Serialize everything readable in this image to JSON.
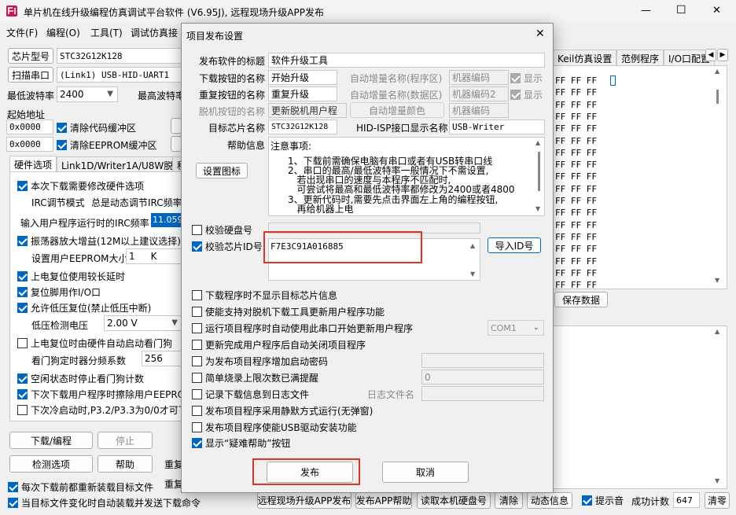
{
  "window": {
    "title": "单片机在线升级编程仿真调试平台软件 (V6.95J), 远程现场升级APP发布",
    "controls": {
      "minimize": "—",
      "maximize": "☐",
      "close": "✕"
    }
  },
  "menu": [
    "文件(F)",
    "编程(O)",
    "工具(T)",
    "调试仿真接"
  ],
  "left": {
    "chip_type_label": "芯片型号",
    "chip_type_value": "STC32G12K128",
    "scan_port_label": "扫描串口",
    "port_value": "(Link1) USB-HID-UART1",
    "min_baud_label": "最低波特率",
    "min_baud_value": "2400",
    "max_baud_label": "最高波特率",
    "start_addr_label": "起始地址",
    "addr1": "0x0000",
    "clear_code": "清除代码缓冲区",
    "addr2": "0x0000",
    "clear_eeprom": "清除EEPROM缓冲区",
    "tabs": [
      "硬件选项",
      "Link1D/Writer1A/U8W脱机",
      "程"
    ],
    "options": {
      "modify_hw": "本次下载需要修改硬件选项",
      "irc_mode_label": "IRC调节模式",
      "irc_mode_value": "总是动态调节IRC频率",
      "irc_freq_label": "输入用户程序运行时的IRC频率",
      "irc_freq_value": "11.0592",
      "osc_gain": "振荡器放大增益(12M以上建议选择)",
      "eeprom_size_label": "设置用户EEPROM大小",
      "eeprom_size_value": "1",
      "eeprom_size_unit": "K",
      "por_delay": "上电复位使用较长延时",
      "reset_io": "复位脚用作I/O口",
      "lvr": "允许低压复位(禁止低压中断)",
      "lvd_label": "低压检测电压",
      "lvd_value": "2.00 V",
      "wdt_auto": "上电复位时由硬件自动启动看门狗",
      "wdt_div_label": "看门狗定时器分频系数",
      "wdt_div_value": "256",
      "wdt_idle": "空闲状态时停止看门狗计数",
      "erase_eeprom": "下次下载用户程序时擦除用户EEPROM",
      "p32p33": "下次冷启动时,P3.2/P3.3为0/0才可下"
    },
    "btn_download": "下载/编程",
    "btn_stop": "停止",
    "btn_check": "检测选项",
    "btn_help": "帮助",
    "redl1": "重复",
    "redl2": "重复",
    "reload_each": "每次下载前都重新装载目标文件",
    "auto_send": "当目标文件变化时自动装载并发送下载命令"
  },
  "right": {
    "tabs": [
      "Keil仿真设置",
      "范例程序",
      "I/O口配置"
    ],
    "hex_line": "FF FF FF",
    "save_data": "保存数据"
  },
  "bottom": {
    "remote_publish": "远程现场升级APP发布",
    "publish_help": "发布APP帮助",
    "read_disk": "读取本机硬盘号",
    "clear": "清除",
    "dyn_info": "动态信息",
    "beep": "提示音",
    "success_count_label": "成功计数",
    "success_count": "647",
    "clear_zero": "清零"
  },
  "dialog": {
    "title": "项目发布设置",
    "close": "✕",
    "publish_title_label": "发布软件的标题",
    "publish_title_value": "软件升级工具",
    "dl_btn_name_label": "下载按钮的名称",
    "dl_btn_name_value": "开始升级",
    "auto_inc_prog_label": "自动增量名称(程序区)",
    "machine_code1": "机器编码",
    "show1": "显示",
    "re_btn_name_label": "重复按钮的名称",
    "re_btn_name_value": "重复升级",
    "auto_inc_data_label": "自动增量名称(数据区)",
    "machine_code2": "机器编码2",
    "show2": "显示",
    "offline_btn_label": "脱机按钮的名称",
    "offline_btn_value": "更新脱机用户程",
    "auto_inc_color": "自动增量颜色",
    "machine_code3": "机器编码",
    "target_chip_label": "目标芯片名称",
    "target_chip_value": "STC32G12K128",
    "hid_name_label": "HID-ISP接口显示名称",
    "hid_name_value": "USB-Writer",
    "help_label": "帮助信息",
    "help_text_title": "注意事项:",
    "help_lines": [
      "1、下载前需确保电脑有串口或者有USB转串口线",
      "2、串口的最高/最低波特率一般情况下不需设置,",
      "   若出现串口的速度与本程序不匹配时,",
      "   可尝试将最高和最低波特率都修改为2400或者4800",
      "3、更新代码时,需要先点击界面左上角的编程按钮,",
      "   再给机器上电"
    ],
    "set_icon": "设置图标",
    "verify_disk": "校验硬盘号",
    "verify_chip": "校验芯片ID号",
    "chip_id_value": "F7E3C91A016885",
    "import_id": "导入ID号",
    "opt1": "下载程序时不显示目标芯片信息",
    "opt2": "使能支持对脱机下载工具更新用户程序功能",
    "opt3": "运行项目程序时自动使用此串口开始更新用户程序",
    "com_value": "COM1",
    "opt4": "更新完成用户程序后自动关闭项目程序",
    "opt5": "为发布项目程序增加启动密码",
    "opt6": "简单烧录上限次数已满提醒",
    "limit_value": "0",
    "opt7": "记录下载信息到日志文件",
    "log_label": "日志文件名",
    "opt8": "发布项目程序采用静默方式运行(无弹窗)",
    "opt9": "发布项目程序使能USB驱动安装功能",
    "opt10": "显示“疑难帮助”按钮",
    "publish_btn": "发布",
    "cancel_btn": "取消"
  },
  "colors": {
    "accent": "#0067c0",
    "highlight": "#e0312a"
  }
}
